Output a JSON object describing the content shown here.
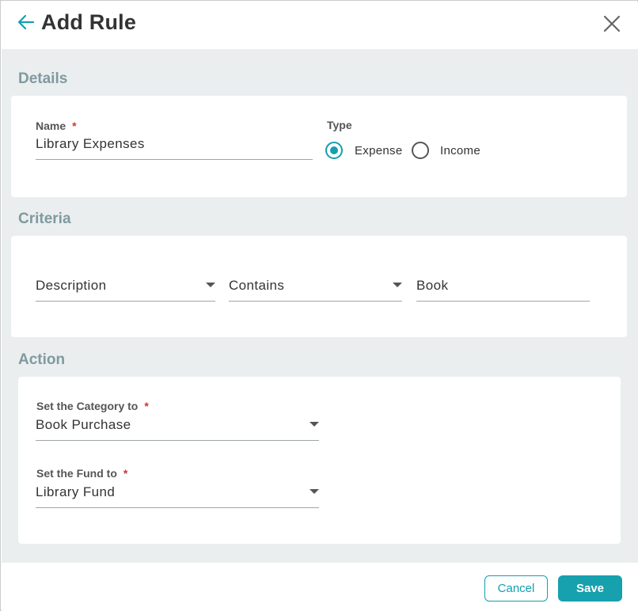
{
  "header": {
    "title": "Add Rule",
    "back_icon": "arrow-left-icon",
    "close_icon": "close-icon"
  },
  "colors": {
    "accent": "#13a0ad",
    "section_title": "#7f9aa0",
    "background": "#ebeeef",
    "required": "#d0342c"
  },
  "details": {
    "section_title": "Details",
    "name_label": "Name",
    "required_mark": "*",
    "name_value": "Library Expenses",
    "type_label": "Type",
    "type_options": [
      {
        "label": "Expense",
        "selected": true
      },
      {
        "label": "Income",
        "selected": false
      }
    ]
  },
  "criteria": {
    "section_title": "Criteria",
    "field_value": "Description",
    "operator_value": "Contains",
    "match_value": "Book"
  },
  "action": {
    "section_title": "Action",
    "category_label": "Set the Category to",
    "category_value": "Book Purchase",
    "fund_label": "Set the Fund to",
    "fund_value": "Library Fund",
    "required_mark": "*"
  },
  "footer": {
    "cancel_label": "Cancel",
    "save_label": "Save"
  }
}
